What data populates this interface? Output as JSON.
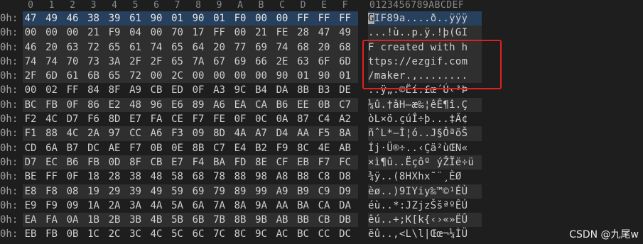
{
  "header": {
    "hex_columns": [
      "0",
      "1",
      "2",
      "3",
      "4",
      "5",
      "6",
      "7",
      "8",
      "9",
      "A",
      "B",
      "C",
      "D",
      "E",
      "F"
    ],
    "ascii_header": "0123456789ABCDEF"
  },
  "rows": [
    {
      "offset": "0h:",
      "bytes": [
        "47",
        "49",
        "46",
        "38",
        "39",
        "61",
        "90",
        "01",
        "90",
        "01",
        "F0",
        "00",
        "00",
        "FF",
        "FF",
        "FF"
      ],
      "ascii": "GIF89a....ð..ÿÿÿ",
      "style": "sel"
    },
    {
      "offset": "0h:",
      "bytes": [
        "00",
        "00",
        "00",
        "21",
        "F9",
        "04",
        "00",
        "70",
        "17",
        "FF",
        "00",
        "21",
        "FE",
        "28",
        "47",
        "49"
      ],
      "ascii": "...!ù..p.ÿ.!þ(GI",
      "style": "gray"
    },
    {
      "offset": "0h:",
      "bytes": [
        "46",
        "20",
        "63",
        "72",
        "65",
        "61",
        "74",
        "65",
        "64",
        "20",
        "77",
        "69",
        "74",
        "68",
        "20",
        "68"
      ],
      "ascii": "F created with h",
      "style": "gray"
    },
    {
      "offset": "0h:",
      "bytes": [
        "74",
        "74",
        "70",
        "73",
        "3A",
        "2F",
        "2F",
        "65",
        "7A",
        "67",
        "69",
        "66",
        "2E",
        "63",
        "6F",
        "6D"
      ],
      "ascii": "ttps://ezgif.com",
      "style": "gray"
    },
    {
      "offset": "0h:",
      "bytes": [
        "2F",
        "6D",
        "61",
        "6B",
        "65",
        "72",
        "00",
        "2C",
        "00",
        "00",
        "00",
        "00",
        "90",
        "01",
        "90",
        "01"
      ],
      "ascii": "/maker.,........",
      "style": "gray"
    },
    {
      "offset": "0h:",
      "bytes": [
        "00",
        "02",
        "FF",
        "84",
        "8F",
        "A9",
        "CB",
        "ED",
        "0F",
        "A3",
        "9C",
        "B4",
        "DA",
        "8B",
        "B3",
        "DE"
      ],
      "ascii": "..ÿ„.©Ëí.£œ´Ú‹³Þ",
      "style": "plain"
    },
    {
      "offset": "0h:",
      "bytes": [
        "BC",
        "FB",
        "0F",
        "86",
        "E2",
        "48",
        "96",
        "E6",
        "89",
        "A6",
        "EA",
        "CA",
        "B6",
        "EE",
        "0B",
        "C7"
      ],
      "ascii": "¼û.†âH–æ‰¦êÊ¶î.Ç",
      "style": "gray"
    },
    {
      "offset": "0h:",
      "bytes": [
        "F2",
        "4C",
        "D7",
        "F6",
        "8D",
        "E7",
        "FA",
        "CE",
        "F7",
        "FE",
        "0F",
        "0C",
        "0A",
        "87",
        "C4",
        "A2"
      ],
      "ascii": "òL×ö.çúÎ÷þ...‡Ä¢",
      "style": "plain"
    },
    {
      "offset": "0h:",
      "bytes": [
        "F1",
        "88",
        "4C",
        "2A",
        "97",
        "CC",
        "A6",
        "F3",
        "09",
        "8D",
        "4A",
        "A7",
        "D4",
        "AA",
        "F5",
        "8A"
      ],
      "ascii": "ñˆL*—Ì¦ó..J§ÔªõŠ",
      "style": "gray"
    },
    {
      "offset": "0h:",
      "bytes": [
        "CD",
        "6A",
        "B7",
        "DC",
        "AE",
        "F7",
        "0B",
        "0E",
        "8B",
        "C7",
        "E4",
        "B2",
        "F9",
        "8C",
        "4E",
        "AB"
      ],
      "ascii": "Íj·Ü®÷..‹Çä²ùŒN«",
      "style": "plain"
    },
    {
      "offset": "0h:",
      "bytes": [
        "D7",
        "EC",
        "B6",
        "FB",
        "0D",
        "8F",
        "CB",
        "E7",
        "F4",
        "BA",
        "FD",
        "8E",
        "CF",
        "EB",
        "F7",
        "FC"
      ],
      "ascii": "×ì¶û..Ëçôº ýŽÏë÷ü",
      "style": "gray"
    },
    {
      "offset": "0h:",
      "bytes": [
        "BE",
        "FF",
        "0F",
        "18",
        "28",
        "38",
        "48",
        "58",
        "68",
        "78",
        "88",
        "98",
        "A8",
        "B8",
        "C8",
        "D8"
      ],
      "ascii": "¾ÿ..(8HXhx˜¨¸ÈØ",
      "style": "plain"
    },
    {
      "offset": "0h:",
      "bytes": [
        "E8",
        "F8",
        "08",
        "19",
        "29",
        "39",
        "49",
        "59",
        "69",
        "79",
        "89",
        "99",
        "A9",
        "B9",
        "C9",
        "D9"
      ],
      "ascii": "èø..)9IYiy‰™©¹ÉÙ",
      "style": "gray"
    },
    {
      "offset": "0h:",
      "bytes": [
        "E9",
        "F9",
        "09",
        "1A",
        "2A",
        "3A",
        "4A",
        "5A",
        "6A",
        "7A",
        "8A",
        "9A",
        "AA",
        "BA",
        "CA",
        "DA"
      ],
      "ascii": "éù..*:JZjzŠšªºÊÚ",
      "style": "plain"
    },
    {
      "offset": "0h:",
      "bytes": [
        "EA",
        "FA",
        "0A",
        "1B",
        "2B",
        "3B",
        "4B",
        "5B",
        "6B",
        "7B",
        "8B",
        "9B",
        "AB",
        "BB",
        "CB",
        "DB"
      ],
      "ascii": "êú..+;K[k{‹›«»ËÛ",
      "style": "gray"
    },
    {
      "offset": "0h:",
      "bytes": [
        "EB",
        "FB",
        "0B",
        "1C",
        "2C",
        "3C",
        "4C",
        "5C",
        "6C",
        "7C",
        "8C",
        "9C",
        "AC",
        "BC",
        "CC",
        "DC"
      ],
      "ascii": "ëû..,<L\\l|Œœ¬¼ÌÜ",
      "style": "plain"
    }
  ],
  "watermark": "CSDN @九尾w"
}
